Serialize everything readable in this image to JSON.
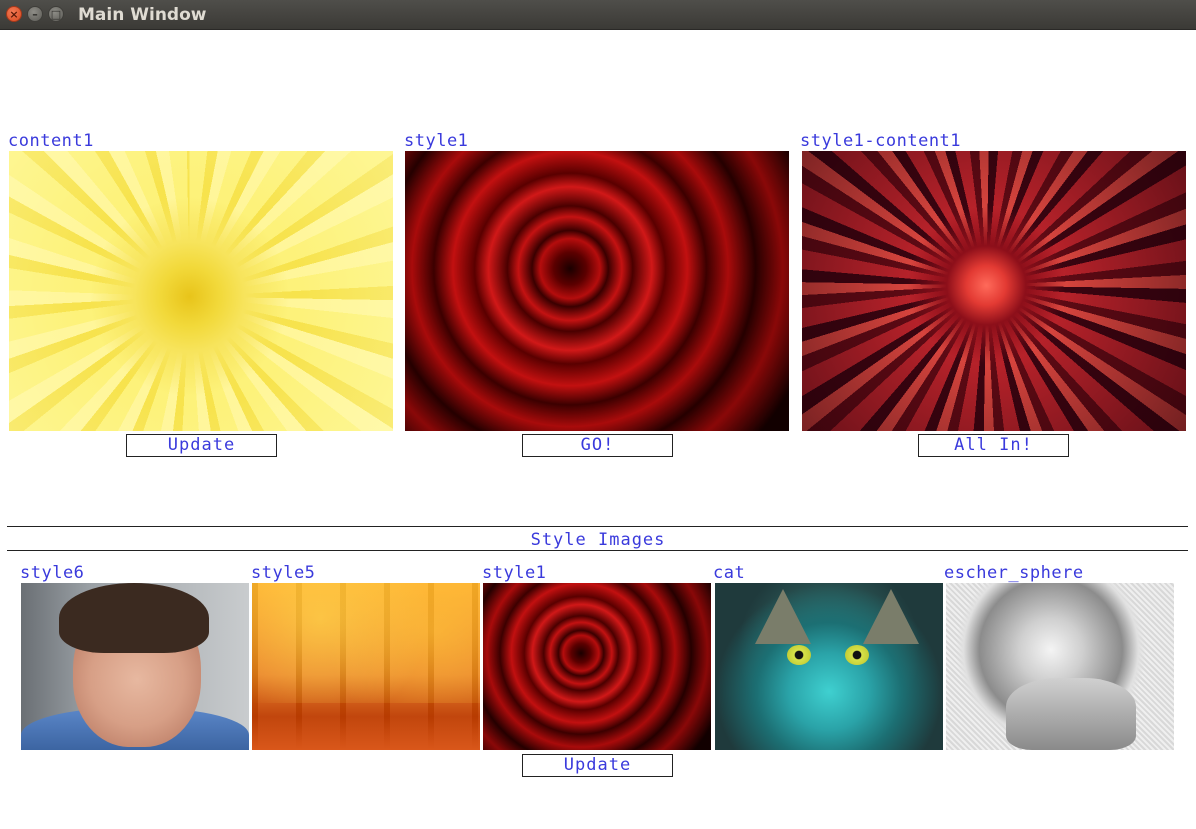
{
  "window": {
    "title": "Main Window",
    "close_glyph": "×",
    "minimize_glyph": "–",
    "maximize_glyph": "□"
  },
  "panels": [
    {
      "label": "content1",
      "image": "yellow-dahlia-photo",
      "button": "Update"
    },
    {
      "label": "style1",
      "image": "red-rose-photo",
      "button": "GO!"
    },
    {
      "label": "style1-content1",
      "image": "stylized-red-dahlia-photo",
      "button": "All In!"
    }
  ],
  "style_section": {
    "title": "Style Images",
    "items": [
      {
        "label": "style6",
        "image": "portrait-photo"
      },
      {
        "label": "style5",
        "image": "autumn-trees-photo"
      },
      {
        "label": "style1",
        "image": "red-rose-photo"
      },
      {
        "label": "cat",
        "image": "stylized-cat-photo"
      },
      {
        "label": "escher_sphere",
        "image": "escher-sphere-drawing"
      }
    ],
    "button": "Update"
  },
  "colors": {
    "label_text": "#3a3adc",
    "titlebar": "#3b3a36",
    "close_button": "#e05a30"
  }
}
